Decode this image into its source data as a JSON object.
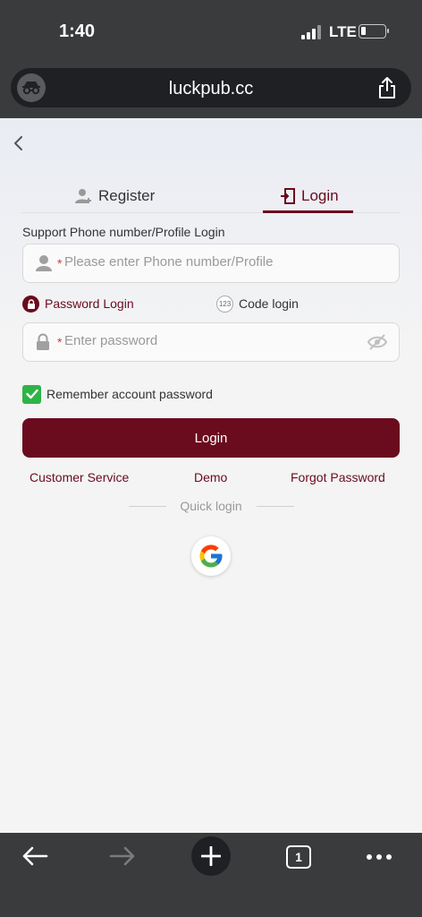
{
  "status_bar": {
    "time": "1:40",
    "network": "LTE"
  },
  "browser": {
    "url": "luckpub.cc",
    "tab_count": "1"
  },
  "tabs": {
    "register_label": "Register",
    "login_label": "Login",
    "active": "login"
  },
  "form": {
    "support_label": "Support Phone number/Profile Login",
    "phone_placeholder": "Please enter Phone number/Profile",
    "password_placeholder": "Enter password",
    "required_mark": "*",
    "password_login_label": "Password Login",
    "code_login_label": "Code login",
    "code_badge": "123",
    "remember_label": "Remember account password",
    "remember_checked": true,
    "login_button": "Login"
  },
  "links": {
    "customer_service": "Customer Service",
    "demo": "Demo",
    "forgot_password": "Forgot Password"
  },
  "quick_login": {
    "label": "Quick login",
    "providers": [
      "google-icon"
    ]
  },
  "colors": {
    "brand": "#6a0b1e",
    "checkbox": "#2eb446",
    "chrome": "#3a3b3d"
  }
}
